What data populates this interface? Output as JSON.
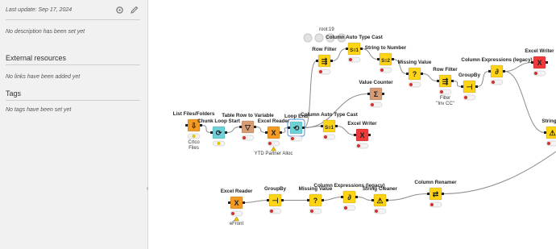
{
  "sidebar": {
    "last_update": "Last update: Sep 17, 2024",
    "description": "No description has been set yet",
    "external_title": "External resources",
    "links_empty": "No links have been added yet",
    "tags_title": "Tags",
    "tags_empty": "No tags have been set yet",
    "collapse_glyph": "‹"
  },
  "canvas": {
    "toolbar_text": "root:19",
    "nodes": [
      {
        "id": "list-files",
        "title": "List Files/Folders",
        "kind": "io",
        "color": "#f29a22",
        "glyph": "⇩",
        "caption": "Crtco\nFiles",
        "status": "yellow"
      },
      {
        "id": "chunk-loop-start",
        "title": "Chunk Loop Start",
        "kind": "loop",
        "color": "#6fd1d8",
        "glyph": "⟳",
        "caption": "",
        "status": "yellow"
      },
      {
        "id": "table-row-to-var",
        "title": "Table Row to Variable",
        "kind": "var",
        "color": "#d79c73",
        "glyph": "▽",
        "caption": "",
        "status": "red"
      },
      {
        "id": "excel-reader-1",
        "title": "Excel Reader",
        "kind": "io",
        "color": "#f29a22",
        "glyph": "X",
        "caption": "YTD Partner Alloc",
        "status": "red",
        "warning": true
      },
      {
        "id": "loop-end",
        "title": "Loop End",
        "kind": "loop",
        "color": "#6fd1d8",
        "glyph": "⟲",
        "caption": "",
        "status": "red",
        "selected": true
      },
      {
        "id": "column-auto-type-cast-1",
        "title": "Column Auto Type Cast",
        "kind": "manip",
        "color": "#ffd414",
        "glyph": "S≡1",
        "caption": "",
        "status": "red"
      },
      {
        "id": "excel-writer-1",
        "title": "Excel Writer",
        "kind": "sink",
        "color": "#ee3a3a",
        "glyph": "X",
        "caption": "",
        "status": "red"
      },
      {
        "id": "value-counter",
        "title": "Value Counter",
        "kind": "var",
        "color": "#d79c73",
        "glyph": "Σ",
        "caption": "",
        "status": "red"
      },
      {
        "id": "row-filter-1",
        "title": "Row Filter",
        "kind": "manip",
        "color": "#ffd414",
        "glyph": "⇶",
        "caption": "",
        "status": "red"
      },
      {
        "id": "column-auto-type-cast-2",
        "title": "Column Auto Type Cast",
        "kind": "manip",
        "color": "#ffd414",
        "glyph": "S≡1",
        "caption": "",
        "status": "red"
      },
      {
        "id": "string-to-number",
        "title": "String to Number",
        "kind": "manip",
        "color": "#ffd414",
        "glyph": "S≡2",
        "caption": "",
        "status": "red"
      },
      {
        "id": "missing-value-1",
        "title": "Missing Value",
        "kind": "manip",
        "color": "#ffd414",
        "glyph": "?",
        "caption": "",
        "status": "red"
      },
      {
        "id": "row-filter-2",
        "title": "Row Filter",
        "kind": "manip",
        "color": "#ffd414",
        "glyph": "⇶",
        "caption": "Filter\n\"Inv CC\"",
        "status": "red"
      },
      {
        "id": "groupby-1",
        "title": "GroupBy",
        "kind": "manip",
        "color": "#ffd414",
        "glyph": "⊣",
        "caption": "",
        "status": "red"
      },
      {
        "id": "column-expressions-1",
        "title": "Column Expressions (legacy)",
        "kind": "manip",
        "color": "#ffd414",
        "glyph": "∂",
        "caption": "",
        "status": "red"
      },
      {
        "id": "excel-writer-2",
        "title": "Excel Writer",
        "kind": "sink",
        "color": "#ee3a3a",
        "glyph": "X",
        "caption": "",
        "status": "red"
      },
      {
        "id": "string-cleaner-1",
        "title": "String Cl",
        "kind": "manip",
        "color": "#ffd414",
        "glyph": "⚠",
        "caption": "",
        "status": "red"
      },
      {
        "id": "excel-reader-2",
        "title": "Excel Reader",
        "kind": "io",
        "color": "#f29a22",
        "glyph": "X",
        "caption": "eFront",
        "status": "red",
        "warning": true
      },
      {
        "id": "groupby-2",
        "title": "GroupBy",
        "kind": "manip",
        "color": "#ffd414",
        "glyph": "⊣",
        "caption": "",
        "status": "red"
      },
      {
        "id": "missing-value-2",
        "title": "Missing Value",
        "kind": "manip",
        "color": "#ffd414",
        "glyph": "?",
        "caption": "",
        "status": "red"
      },
      {
        "id": "column-expressions-2",
        "title": "Column Expressions (legacy)",
        "kind": "manip",
        "color": "#ffd414",
        "glyph": "∂",
        "caption": "",
        "status": "red"
      },
      {
        "id": "string-cleaner-2",
        "title": "String Cleaner",
        "kind": "manip",
        "color": "#ffd414",
        "glyph": "⚠",
        "caption": "",
        "status": "red"
      },
      {
        "id": "column-renamer",
        "title": "Column Renamer",
        "kind": "manip",
        "color": "#ffd414",
        "glyph": "⇄",
        "caption": "",
        "status": "red"
      }
    ]
  }
}
